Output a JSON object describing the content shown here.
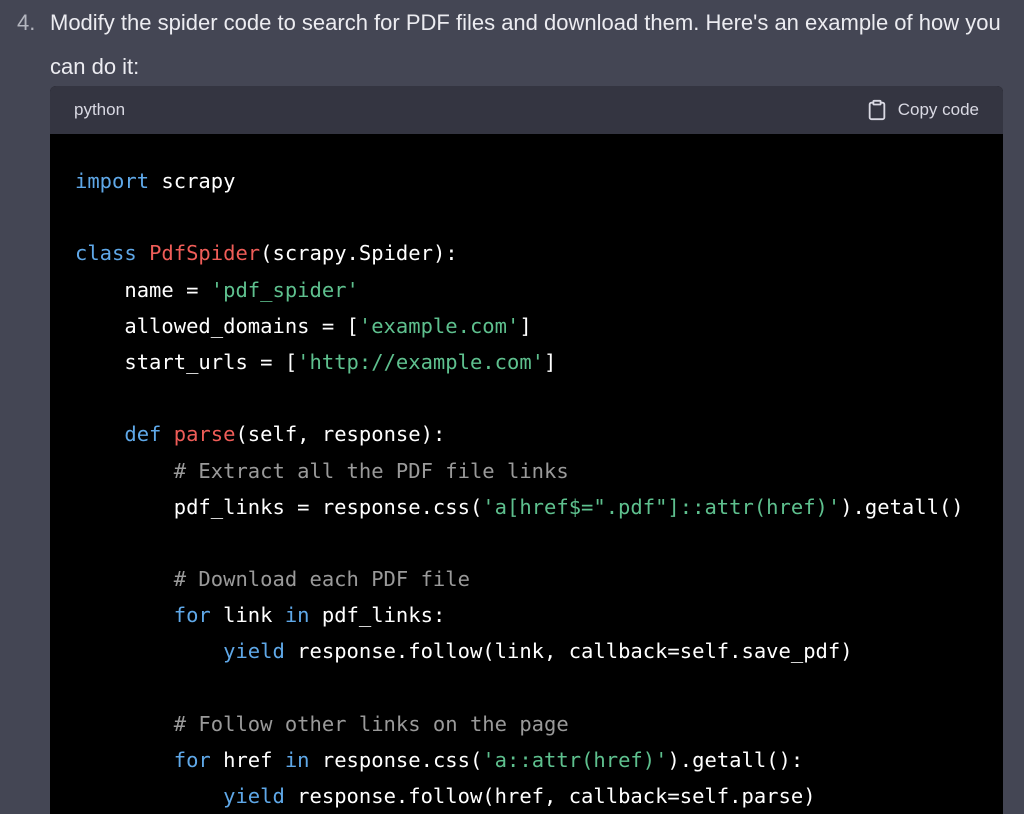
{
  "step": {
    "number": "4.",
    "text": "Modify the spider code to search for PDF files and download them. Here's an example of how you can do it:"
  },
  "code_block": {
    "language": "python",
    "copy_label": "Copy code",
    "copy_icon": "clipboard-icon",
    "lines": [
      [
        {
          "t": "import",
          "c": "kw"
        },
        {
          "t": " scrapy",
          "c": ""
        }
      ],
      [],
      [
        {
          "t": "class",
          "c": "kw"
        },
        {
          "t": " ",
          "c": ""
        },
        {
          "t": "PdfSpider",
          "c": "fn"
        },
        {
          "t": "(scrapy.Spider):",
          "c": ""
        }
      ],
      [
        {
          "t": "    name = ",
          "c": ""
        },
        {
          "t": "'pdf_spider'",
          "c": "str"
        }
      ],
      [
        {
          "t": "    allowed_domains = [",
          "c": ""
        },
        {
          "t": "'example.com'",
          "c": "str"
        },
        {
          "t": "]",
          "c": ""
        }
      ],
      [
        {
          "t": "    start_urls = [",
          "c": ""
        },
        {
          "t": "'http://example.com'",
          "c": "str"
        },
        {
          "t": "]",
          "c": ""
        }
      ],
      [],
      [
        {
          "t": "    ",
          "c": ""
        },
        {
          "t": "def",
          "c": "kw"
        },
        {
          "t": " ",
          "c": ""
        },
        {
          "t": "parse",
          "c": "fn"
        },
        {
          "t": "(self, response):",
          "c": ""
        }
      ],
      [
        {
          "t": "        # Extract all the PDF file links",
          "c": "cm"
        }
      ],
      [
        {
          "t": "        pdf_links = response.css(",
          "c": ""
        },
        {
          "t": "'a[href$=\".pdf\"]::attr(href)'",
          "c": "str"
        },
        {
          "t": ").getall()",
          "c": ""
        }
      ],
      [],
      [
        {
          "t": "        # Download each PDF file",
          "c": "cm"
        }
      ],
      [
        {
          "t": "        ",
          "c": ""
        },
        {
          "t": "for",
          "c": "kw"
        },
        {
          "t": " link ",
          "c": ""
        },
        {
          "t": "in",
          "c": "kw"
        },
        {
          "t": " pdf_links:",
          "c": ""
        }
      ],
      [
        {
          "t": "            ",
          "c": ""
        },
        {
          "t": "yield",
          "c": "kw"
        },
        {
          "t": " response.follow(link, callback=self.save_pdf)",
          "c": ""
        }
      ],
      [],
      [
        {
          "t": "        # Follow other links on the page",
          "c": "cm"
        }
      ],
      [
        {
          "t": "        ",
          "c": ""
        },
        {
          "t": "for",
          "c": "kw"
        },
        {
          "t": " href ",
          "c": ""
        },
        {
          "t": "in",
          "c": "kw"
        },
        {
          "t": " response.css(",
          "c": ""
        },
        {
          "t": "'a::attr(href)'",
          "c": "str"
        },
        {
          "t": ").getall():",
          "c": ""
        }
      ],
      [
        {
          "t": "            ",
          "c": ""
        },
        {
          "t": "yield",
          "c": "kw"
        },
        {
          "t": " response.follow(href, callback=self.parse)",
          "c": ""
        }
      ]
    ]
  },
  "colors": {
    "page_bg": "#444654",
    "code_bg": "#000000",
    "header_bg": "#343541",
    "keyword": "#5fa8e8",
    "name": "#ef5d58",
    "string": "#5ec08e",
    "comment": "#9a9a9a"
  }
}
